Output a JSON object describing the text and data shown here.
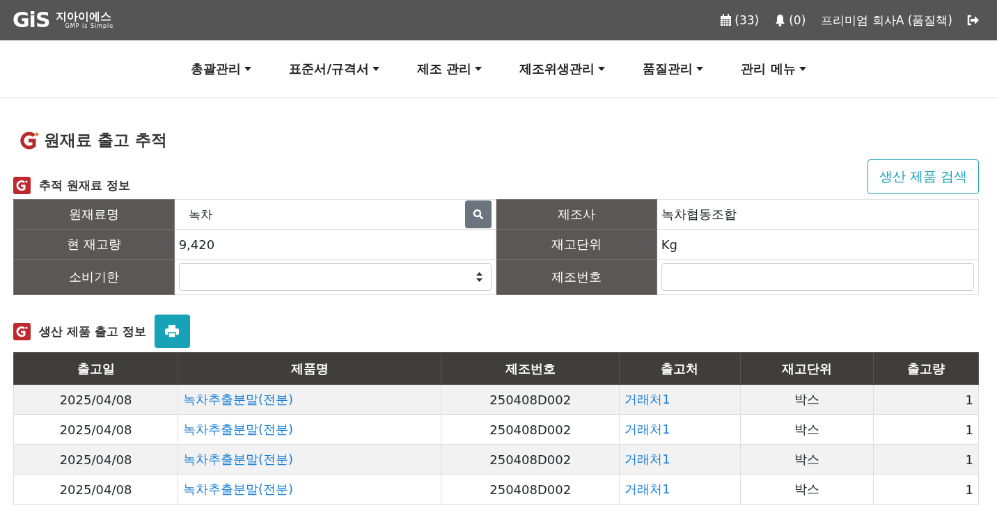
{
  "header": {
    "logo": "GiS",
    "brand": "지아이에스",
    "tagline": "GMP is Simple",
    "calendar_count": "(33)",
    "notification_count": "(0)",
    "user": "프리미엄 회사A (품질책)"
  },
  "nav": [
    {
      "label": "총괄관리"
    },
    {
      "label": "표준서/규격서"
    },
    {
      "label": "제조 관리"
    },
    {
      "label": "제조위생관리"
    },
    {
      "label": "품질관리"
    },
    {
      "label": "관리 메뉴"
    }
  ],
  "page_title": "원재료 출고 추적",
  "info_section": {
    "title": "추적 원재료 정보",
    "search_button": "생산 제품 검색",
    "fields": [
      {
        "label": "원재료명",
        "kind": "search",
        "value": "녹차"
      },
      {
        "label": "제조사",
        "kind": "text",
        "value": "녹차협동조합"
      },
      {
        "label": "현 재고량",
        "kind": "text",
        "value": "9,420"
      },
      {
        "label": "재고단위",
        "kind": "text",
        "value": "Kg"
      },
      {
        "label": "소비기한",
        "kind": "select"
      },
      {
        "label": "제조번호",
        "kind": "input"
      }
    ]
  },
  "output_section": {
    "title": "생산 제품 출고 정보",
    "table": {
      "columns": [
        {
          "label": "출고일",
          "kind": "text"
        },
        {
          "label": "제품명",
          "kind": "link"
        },
        {
          "label": "제조번호",
          "kind": "text"
        },
        {
          "label": "출고처",
          "kind": "link"
        },
        {
          "label": "재고단위",
          "kind": "text"
        },
        {
          "label": "출고량",
          "kind": "number"
        }
      ],
      "rows": [
        [
          "2025/04/08",
          "녹차추출분말(전분)",
          "250408D002",
          "거래처1",
          "박스",
          "1"
        ],
        [
          "2025/04/08",
          "녹차추출분말(전분)",
          "250408D002",
          "거래처1",
          "박스",
          "1"
        ],
        [
          "2025/04/08",
          "녹차추출분말(전분)",
          "250408D002",
          "거래처1",
          "박스",
          "1"
        ],
        [
          "2025/04/08",
          "녹차추출분말(전분)",
          "250408D002",
          "거래처1",
          "박스",
          "1"
        ]
      ]
    }
  }
}
